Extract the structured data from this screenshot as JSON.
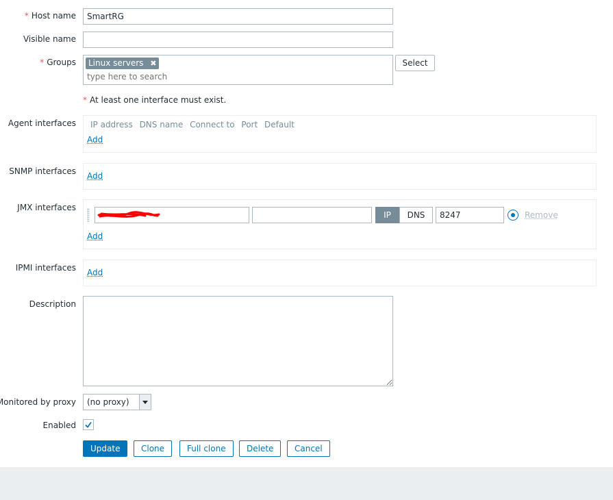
{
  "form": {
    "host_name": {
      "label": "Host name",
      "required": "*",
      "value": "SmartRG"
    },
    "visible_name": {
      "label": "Visible name",
      "value": ""
    },
    "groups": {
      "label": "Groups",
      "required": "*",
      "tag": "Linux servers",
      "tag_remove": "✖",
      "placeholder": "type here to search",
      "select_button": "Select"
    },
    "interface_note": {
      "required": "*",
      "text": "At least one interface must exist."
    },
    "agent_interfaces": {
      "label": "Agent interfaces",
      "columns": [
        "IP address",
        "DNS name",
        "Connect to",
        "Port",
        "Default"
      ],
      "add": "Add"
    },
    "snmp_interfaces": {
      "label": "SNMP interfaces",
      "add": "Add"
    },
    "jmx_interfaces": {
      "label": "JMX interfaces",
      "ip_value": "",
      "dns_value": "",
      "connect_ip": "IP",
      "connect_dns": "DNS",
      "port": "8247",
      "remove": "Remove",
      "add": "Add"
    },
    "ipmi_interfaces": {
      "label": "IPMI interfaces",
      "add": "Add"
    },
    "description": {
      "label": "Description",
      "value": ""
    },
    "proxy": {
      "label": "Monitored by proxy",
      "value": "(no proxy)"
    },
    "enabled": {
      "label": "Enabled",
      "checked": true
    }
  },
  "buttons": {
    "update": "Update",
    "clone": "Clone",
    "full_clone": "Full clone",
    "delete": "Delete",
    "cancel": "Cancel"
  },
  "colors": {
    "accent": "#0275b8",
    "required": "#e45959",
    "redaction": "#ff0000",
    "footer": "#ebeef0"
  }
}
